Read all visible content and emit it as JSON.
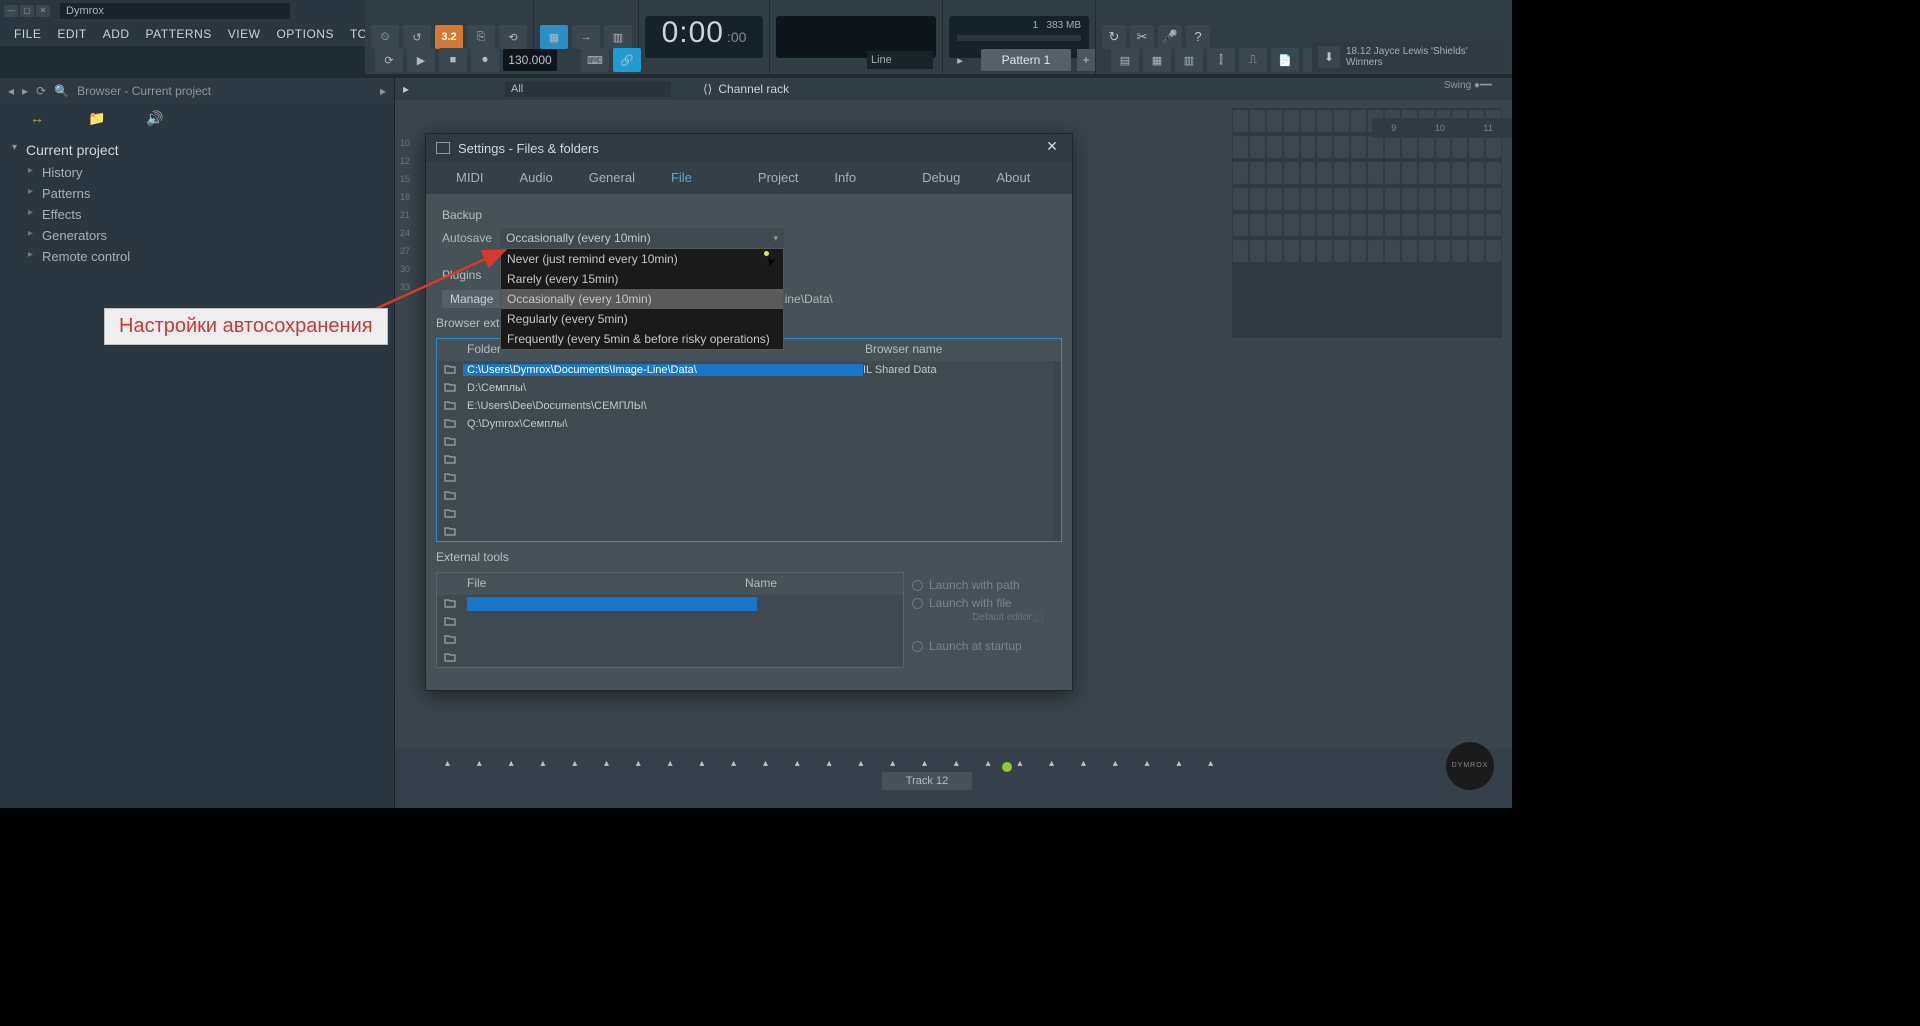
{
  "title": "Dymrox",
  "menu": [
    "FILE",
    "EDIT",
    "ADD",
    "PATTERNS",
    "VIEW",
    "OPTIONS",
    "TOOLS",
    "?"
  ],
  "toolbar": {
    "snap": "3.2",
    "tempo": "130.000",
    "time_big": "0:00",
    "time_small": ":00",
    "cpu": "1",
    "mem": "383 MB",
    "line": "Line",
    "pattern": "Pattern 1"
  },
  "song": {
    "meta": "18.12  Jayce Lewis 'Shields'",
    "title": "Winners"
  },
  "browser": {
    "title": "Browser - Current project",
    "root": "Current project",
    "items": [
      "History",
      "Patterns",
      "Effects",
      "Generators",
      "Remote control"
    ]
  },
  "channel": {
    "all": "All",
    "label": "Channel rack",
    "swing": "Swing"
  },
  "timeline": [
    "9",
    "10",
    "11"
  ],
  "tracknums": [
    "10",
    "12",
    "15",
    "18",
    "21",
    "24",
    "27",
    "30",
    "33"
  ],
  "track": "Track 12",
  "dlg": {
    "title": "Settings - Files & folders",
    "tabs": [
      "MIDI",
      "Audio",
      "General",
      "File",
      "Project",
      "Info",
      "Debug",
      "About"
    ],
    "active_tab": "File",
    "backup": "Backup",
    "autosave_lbl": "Autosave",
    "autosave_val": "Occasionally (every 10min)",
    "dd": [
      "Never (just remind every 10min)",
      "Rarely (every 15min)",
      "Occasionally (every 10min)",
      "Regularly (every 5min)",
      "Frequently (every 5min & before risky operations)"
    ],
    "plugins": "Plugins",
    "manage": "Manage",
    "pluginpath": "e-Line\\Data\\",
    "browserextra": "Browser extra search folders",
    "fh_folder": "Folder",
    "fh_name": "Browser name",
    "folders": [
      {
        "path": "C:\\Users\\Dymrox\\Documents\\Image-Line\\Data\\",
        "name": "IL Shared Data",
        "sel": true
      },
      {
        "path": "D:\\Семплы\\",
        "name": ""
      },
      {
        "path": "E:\\Users\\Dee\\Documents\\СЕМПЛЫ\\",
        "name": ""
      },
      {
        "path": "Q:\\Dymrox\\Семплы\\",
        "name": ""
      },
      {
        "path": "",
        "name": ""
      },
      {
        "path": "",
        "name": ""
      },
      {
        "path": "",
        "name": ""
      },
      {
        "path": "",
        "name": ""
      },
      {
        "path": "",
        "name": ""
      },
      {
        "path": "",
        "name": ""
      }
    ],
    "external": "External tools",
    "eh_file": "File",
    "eh_name": "Name",
    "launch_path": "Launch with path",
    "launch_file": "Launch with file",
    "default_editor": "Default editor",
    "launch_startup": "Launch at startup"
  },
  "callout": "Настройки автосохранения",
  "watermark": "DYMROX"
}
